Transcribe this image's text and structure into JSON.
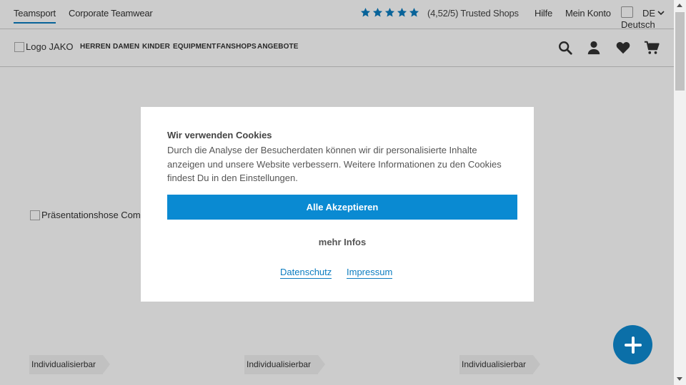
{
  "topbar": {
    "links": [
      "Teamsport",
      "Corporate Teamwear"
    ],
    "rating": "(4,52/5) Trusted Shops",
    "help": "Hilfe",
    "account": "Mein Konto",
    "language_alt": "Deutsch",
    "language_code": "DE"
  },
  "nav": {
    "logo_alt": "Logo JAKO",
    "items": [
      "HERREN",
      "DAMEN",
      "KINDER",
      "EQUIPMENT",
      "FANSHOPS",
      "ANGEBOTE"
    ]
  },
  "content": {
    "product_image_alt": "Präsentationshose Com",
    "tags": [
      "Individualisierbar",
      "Individualisierbar",
      "Individualisierbar"
    ]
  },
  "cookie_modal": {
    "title": "Wir verwenden Cookies",
    "text": "Durch die Analyse der Besucherdaten können wir dir personalisierte Inhalte anzeigen und unsere Website verbessern. Weitere Informationen zu den Cookies findest Du in den Einstellungen.",
    "accept_label": "Alle Akzeptieren",
    "more_label": "mehr Infos",
    "privacy_link": "Datenschutz",
    "imprint_link": "Impressum"
  },
  "colors": {
    "accent": "#0a7cc0",
    "button": "#0a8ad2",
    "fab": "#0b6fa8"
  },
  "icons": [
    "star-icon",
    "chevron-down-icon",
    "search-icon",
    "user-icon",
    "heart-icon",
    "cart-icon",
    "plus-icon"
  ]
}
